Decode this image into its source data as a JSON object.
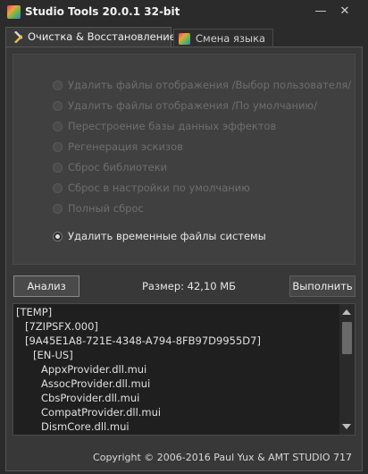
{
  "window": {
    "title": "Studio Tools 20.0.1  32-bit",
    "minimize_glyph": "—",
    "close_glyph": "✕"
  },
  "tabs": [
    {
      "label": "Очистка & Восстановление",
      "active": true
    },
    {
      "label": "Смена языка",
      "active": false
    }
  ],
  "options": [
    {
      "label": "Удалить файлы отображения /Выбор пользователя/",
      "enabled": false
    },
    {
      "label": "Удалить файлы отображения /По умолчанию/",
      "enabled": false
    },
    {
      "label": "Перестроение базы данных эффектов",
      "enabled": false
    },
    {
      "label": "Регенерация эскизов",
      "enabled": false
    },
    {
      "label": "Сброс библиотеки",
      "enabled": false
    },
    {
      "label": "Сброс в настройки по умолчанию",
      "enabled": false
    },
    {
      "label": "Полный сброс",
      "enabled": false
    },
    {
      "label": "Удалить временные файлы системы",
      "enabled": true,
      "selected": true
    }
  ],
  "actions": {
    "analyze_label": "Анализ",
    "size_text": "Размер: 42,10 МБ",
    "run_label": "Выполнить"
  },
  "log": {
    "lines": [
      "[TEMP]",
      "[7ZIPSFX.000]",
      "[9A45E1A8-721E-4348-A794-8FB97D9955D7]",
      "[EN-US]",
      "AppxProvider.dll.mui",
      "AssocProvider.dll.mui",
      "CbsProvider.dll.mui",
      "CompatProvider.dll.mui",
      "DismCore.dll.mui"
    ]
  },
  "footer": {
    "copyright": "Copyright © 2006-2016 Paul Yux & AMT STUDIO 717"
  },
  "icons": {
    "app": "app-logo-icon",
    "tab_cleanup": "wrench-screwdriver-icon",
    "tab_language": "app-logo-icon"
  }
}
